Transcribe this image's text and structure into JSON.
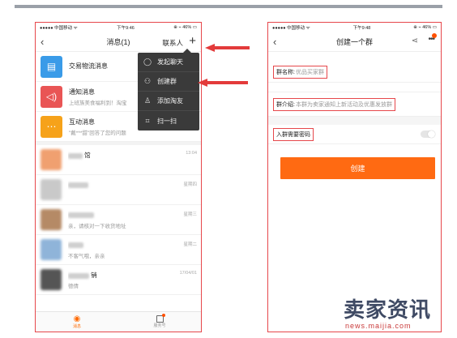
{
  "left": {
    "status": {
      "carrier": "●●●●● 中国移动 ᯤ",
      "time": "下午9:46",
      "battery": "⊕ ⌁ 46% ▭"
    },
    "nav": {
      "back": "‹",
      "title": "消息(1)",
      "contacts": "联系人",
      "plus": "+"
    },
    "system_messages": [
      {
        "title": "交易物流消息",
        "subtitle": "",
        "color": "#3a9be8",
        "icon": "package-icon",
        "glyph": "▤"
      },
      {
        "title": "通知消息",
        "subtitle": "上班族美食福利到！淘宝",
        "color": "#e95555",
        "icon": "speaker-icon",
        "glyph": "◁)"
      },
      {
        "title": "互动消息",
        "subtitle": "\"戴***甜\"回答了您的问题",
        "color": "#f6a21a",
        "icon": "chat-icon",
        "glyph": "⋯"
      }
    ],
    "contacts": [
      {
        "name": "馆",
        "preview": "",
        "time": "13:04",
        "avatar": "#f0a070"
      },
      {
        "name": "",
        "preview": "",
        "time": "星期四",
        "avatar": "#c9c9c9"
      },
      {
        "name": "",
        "preview": "亲，请核对一下收货地址",
        "time": "星期三",
        "avatar": "#b58a66"
      },
      {
        "name": "",
        "preview": "不客气哦，亲亲",
        "time": "星期二",
        "avatar": "#8fb4d9"
      },
      {
        "name": "销",
        "preview": "德倩",
        "time": "17/04/01",
        "avatar": "#555555"
      }
    ],
    "dropdown": [
      {
        "label": "发起聊天",
        "icon": "chat-bubble-icon",
        "glyph": "◯"
      },
      {
        "label": "创建群",
        "icon": "group-icon",
        "glyph": "⚇"
      },
      {
        "label": "添加淘友",
        "icon": "add-friend-icon",
        "glyph": "♙"
      },
      {
        "label": "扫一扫",
        "icon": "scan-icon",
        "glyph": "⌗"
      }
    ],
    "tabs": [
      {
        "label": "消息",
        "icon": "message-tab-icon",
        "glyph": "◉"
      },
      {
        "label": "服务号",
        "icon": "service-tab-icon",
        "glyph": ""
      }
    ]
  },
  "right": {
    "status": {
      "carrier": "●●●●● 中国移动 ᯤ",
      "time": "下午9:48",
      "battery": "⊕ ⌁ 46% ▭"
    },
    "nav": {
      "back": "‹",
      "title": "创建一个群",
      "share": "⋖",
      "more": "•••"
    },
    "group_name": {
      "label": "群名称:",
      "value": "优品买家群"
    },
    "group_intro": {
      "label": "群介绍:",
      "value": "本群为卖家通知上新活动及优惠发放群"
    },
    "password": {
      "label": "入群需要密码",
      "enabled": false
    },
    "create_button": "创建"
  },
  "watermark": {
    "brand": "卖家资讯",
    "domain": "news.maijia.com"
  },
  "colors": {
    "accent": "#ff6a12",
    "highlight": "#e6474b"
  }
}
